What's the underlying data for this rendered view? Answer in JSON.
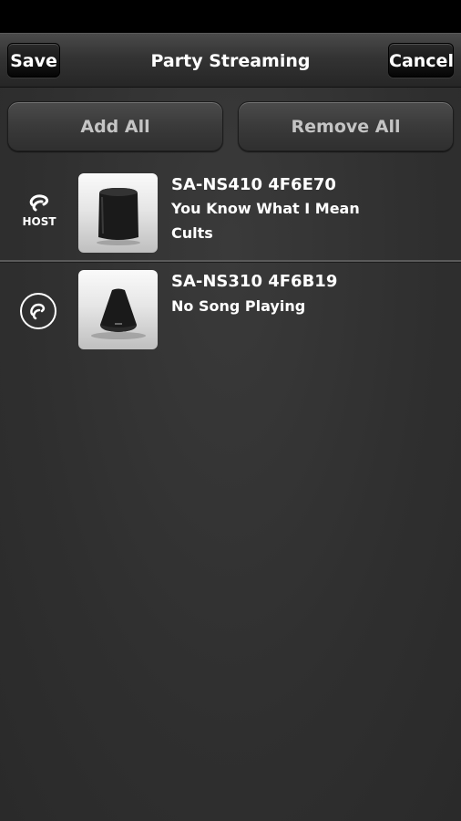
{
  "header": {
    "save_label": "Save",
    "title": "Party Streaming",
    "cancel_label": "Cancel"
  },
  "actions": {
    "add_all_label": "Add All",
    "remove_all_label": "Remove All"
  },
  "devices": [
    {
      "name": "SA-NS410 4F6E70",
      "line1": "You Know What I Mean",
      "line2": "Cults",
      "role_label": "HOST",
      "icon": "party-host-icon"
    },
    {
      "name": "SA-NS310 4F6B19",
      "line1": "No Song Playing",
      "icon": "party-guest-icon"
    }
  ]
}
